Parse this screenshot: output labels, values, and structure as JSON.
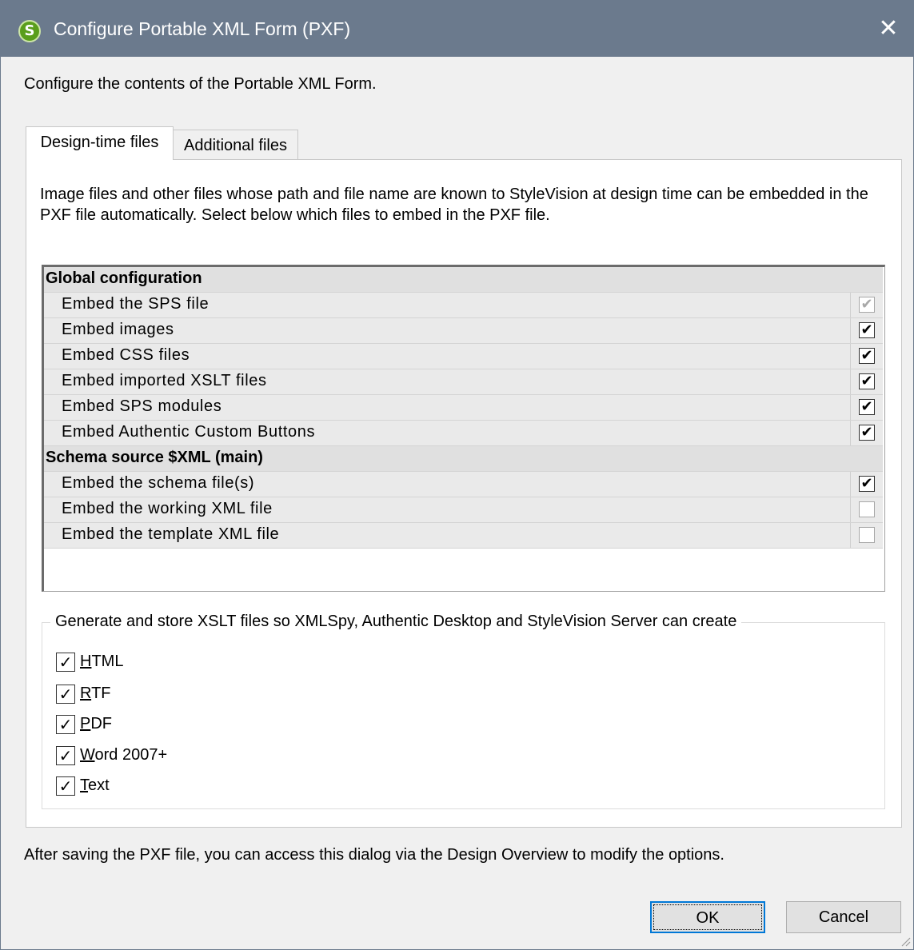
{
  "window": {
    "title": "Configure Portable XML Form (PXF)",
    "close_glyph": "✕",
    "app_icon_glyph": "S"
  },
  "intro": "Configure the contents of the Portable XML Form.",
  "tabs": [
    {
      "label": "Design-time files",
      "active": true
    },
    {
      "label": "Additional files",
      "active": false
    }
  ],
  "panel": {
    "description": "Image files and other files whose path and file name are known to StyleVision at design time can be embedded in the PXF file automatically. Select below which files to embed in the PXF file."
  },
  "grid": {
    "rows": [
      {
        "type": "group",
        "label": "Global configuration"
      },
      {
        "type": "item",
        "label": "Embed the SPS file",
        "checked": true,
        "disabled": true
      },
      {
        "type": "item",
        "label": "Embed images",
        "checked": true
      },
      {
        "type": "item",
        "label": "Embed CSS files",
        "checked": true
      },
      {
        "type": "item",
        "label": "Embed imported XSLT files",
        "checked": true
      },
      {
        "type": "item",
        "label": "Embed SPS modules",
        "checked": true
      },
      {
        "type": "item",
        "label": "Embed Authentic Custom Buttons",
        "checked": true
      },
      {
        "type": "group",
        "label": "Schema source $XML (main)"
      },
      {
        "type": "item",
        "label": "Embed the schema file(s)",
        "checked": true
      },
      {
        "type": "item",
        "label": "Embed the working XML file",
        "checked": false
      },
      {
        "type": "item",
        "label": "Embed the template XML file",
        "checked": false
      }
    ]
  },
  "xslt_group": {
    "legend": "Generate and store XSLT files so XMLSpy, Authentic Desktop and StyleVision Server can create",
    "options": [
      {
        "mnemonic": "H",
        "rest": "TML",
        "checked": true
      },
      {
        "mnemonic": "R",
        "rest": "TF",
        "checked": true
      },
      {
        "mnemonic": "P",
        "rest": "DF",
        "checked": true
      },
      {
        "mnemonic": "W",
        "rest": "ord 2007+",
        "checked": true
      },
      {
        "mnemonic": "T",
        "rest": "ext",
        "checked": true
      }
    ]
  },
  "footer_note": "After saving the PXF file, you can access this dialog via the Design Overview to modify the options.",
  "buttons": {
    "ok": "OK",
    "cancel": "Cancel"
  },
  "check_glyph": "✔",
  "opt_check_glyph": "✓"
}
